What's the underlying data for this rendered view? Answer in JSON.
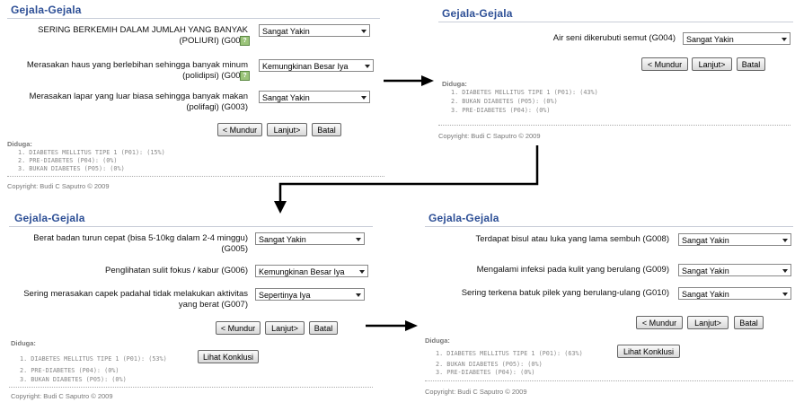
{
  "panel_title": "Gejala-Gejala",
  "diduga_label": "Diduga:",
  "copyright": "Copyright: Budi C Saputro © 2009",
  "help_glyph": "?",
  "buttons": {
    "back": "< Mundur",
    "next": "Lanjut>",
    "cancel": "Batal",
    "conclude": "Lihat Konklusi"
  },
  "panels": [
    {
      "questions": [
        {
          "text": "SERING BERKEMIH DALAM JUMLAH YANG BANYAK (POLIURI) (G001)",
          "answer": "Sangat Yakin",
          "help": true
        },
        {
          "text": "Merasakan haus yang berlebihan sehingga banyak minum (polidipsi) (G002)",
          "answer": "Kemungkinan Besar Iya",
          "help": true
        },
        {
          "text": "Merasakan lapar yang luar biasa sehingga banyak makan (polifagi) (G003)",
          "answer": "Sangat Yakin",
          "help": false
        }
      ],
      "results": [
        "1. DIABETES MELLITUS TIPE 1 (P01): (15%)",
        "2. PRE-DIABETES (P04): (0%)",
        "3. BUKAN DIABETES (P05): (0%)"
      ]
    },
    {
      "questions": [
        {
          "text": "Air seni dikerubuti semut (G004)",
          "answer": "Sangat Yakin",
          "help": false
        }
      ],
      "results": [
        "1. DIABETES MELLITUS TIPE 1 (P01): (43%)",
        "2. BUKAN DIABETES (P05): (0%)",
        "3. PRE-DIABETES (P04): (0%)"
      ]
    },
    {
      "questions": [
        {
          "text": "Berat badan turun cepat (bisa 5-10kg dalam 2-4 minggu) (G005)",
          "answer": "Sangat Yakin",
          "help": false
        },
        {
          "text": "Penglihatan sulit fokus / kabur (G006)",
          "answer": "Kemungkinan Besar Iya",
          "help": false
        },
        {
          "text": "Sering merasakan capek padahal tidak melakukan aktivitas yang berat (G007)",
          "answer": "Sepertinya Iya",
          "help": false
        }
      ],
      "results": [
        "1. DIABETES MELLITUS TIPE 1 (P01): (53%)",
        "2. PRE-DIABETES (P04): (0%)",
        "3. BUKAN DIABETES (P05): (0%)"
      ]
    },
    {
      "questions": [
        {
          "text": "Terdapat bisul atau luka yang lama sembuh (G008)",
          "answer": "Sangat Yakin",
          "help": false
        },
        {
          "text": "Mengalami infeksi pada kulit yang berulang (G009)",
          "answer": "Sangat Yakin",
          "help": false
        },
        {
          "text": "Sering terkena batuk pilek yang berulang-ulang (G010)",
          "answer": "Sangat Yakin",
          "help": false
        }
      ],
      "results": [
        "1. DIABETES MELLITUS TIPE 1 (P01): (63%)",
        "2. BUKAN DIABETES (P05): (0%)",
        "3. PRE-DIABETES (P04): (0%)"
      ]
    }
  ]
}
